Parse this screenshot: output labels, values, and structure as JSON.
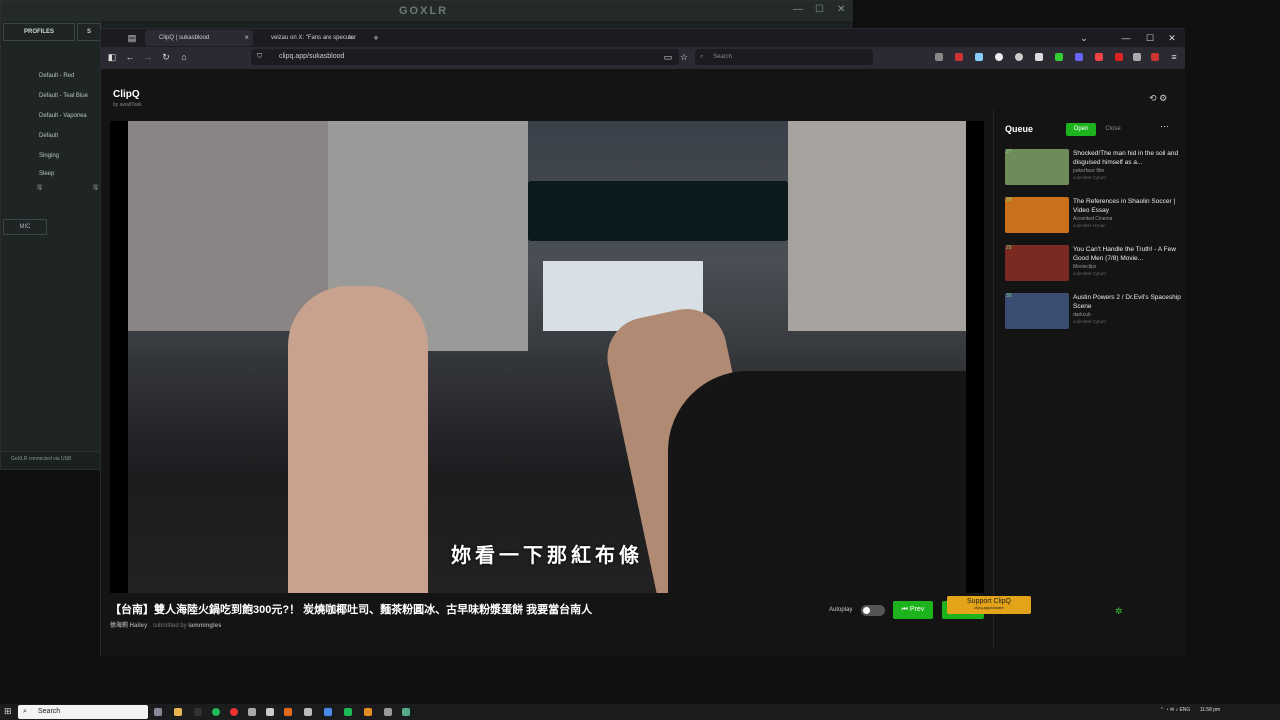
{
  "goxlr": {
    "title": "GOXLR",
    "tab_profiles": "PROFILES",
    "tab_other": "S",
    "profiles": [
      "Default - Red",
      "Default - Teal Blue",
      "Default - Vaporwa",
      "Default",
      "Singing",
      "Sleep"
    ],
    "mic_tab": "MIC",
    "status": "GoXLR connected via USB"
  },
  "browser": {
    "tabs": [
      {
        "label": "ClipQ | sukasblood",
        "active": true
      },
      {
        "label": "velzau on X: \"Fans are specular",
        "active": false
      }
    ],
    "url": "clipq.app/sukasblood",
    "search_placeholder": "Search"
  },
  "app": {
    "name": "ClipQ",
    "by": "by awaitTask"
  },
  "video": {
    "subtitle": "妳看一下那紅布條",
    "title": "【台南】雙人海陸火鍋吃到飽300元?！ 炭燒咖椰吐司、麵茶粉圓冰、古早味粉漿蛋餅 我要當台南人",
    "channel": "徐海莉 Hailey",
    "submitted_prefix": "· submitted by",
    "submitter": "iammingles"
  },
  "controls": {
    "autoplay_label": "Autoplay",
    "autoplay_on": false,
    "prev_label": "⏮ Prev",
    "next_label": "Next ⏭"
  },
  "queue": {
    "label": "Queue",
    "open_label": "Open",
    "close_label": "Close",
    "items": [
      {
        "num": "27",
        "title": "Shocked!The man hid in the soil and disguised himself as a...",
        "channel": "pokerface film",
        "submitter": "submitter Cyturn",
        "color": "#6e8c5a"
      },
      {
        "num": "28",
        "title": "The References in Shaolin Soccer | Video Essay",
        "channel": "Accented Cinema",
        "submitter": "submitter H1van",
        "color": "#c9711b"
      },
      {
        "num": "29",
        "title": "You Can't Handle the Truth! - A Few Good Men (7/8) Movie...",
        "channel": "Movieclips",
        "submitter": "submitter Cyturn",
        "color": "#7a2a20"
      },
      {
        "num": "30",
        "title": "Austin Powers 2 / Dr.Evil's Spaceship Scene",
        "channel": "darkcub",
        "submitter": "submitter Cyturn",
        "color": "#3b4d73"
      }
    ]
  },
  "support": {
    "label": "Support ClipQ",
    "sub": "clipq.app/donate"
  },
  "taskbar": {
    "search": "Search",
    "lang": "ENG",
    "time": "11:58 pm"
  }
}
